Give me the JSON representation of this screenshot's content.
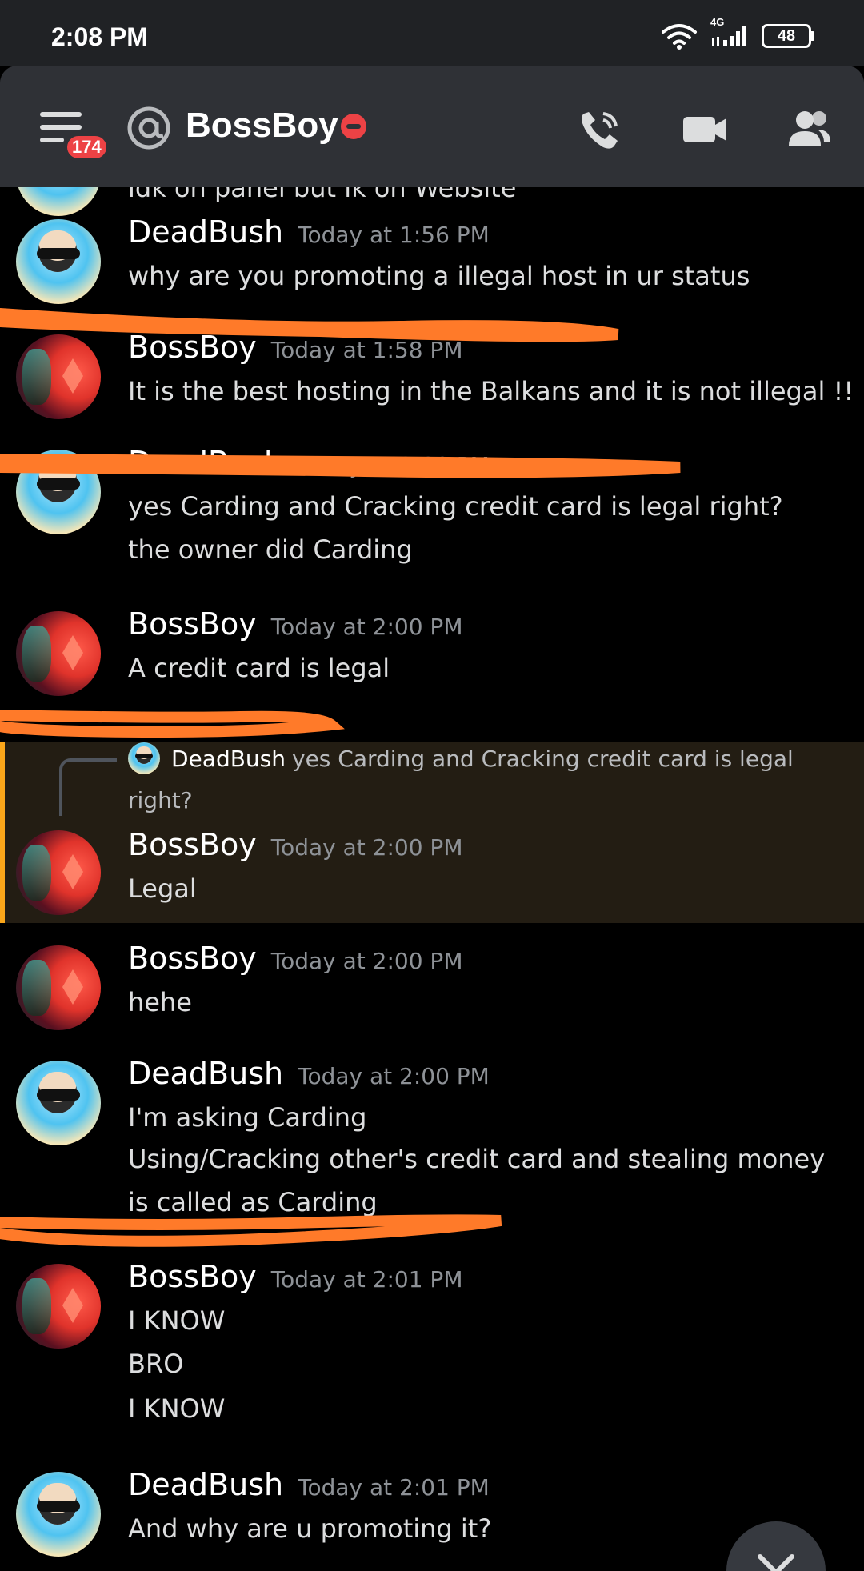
{
  "status_bar": {
    "time": "2:08 PM",
    "network": "4G",
    "battery": "48"
  },
  "header": {
    "unread_badge": "174",
    "channel_name": "BossBoy",
    "status": "do-not-disturb",
    "icons": [
      "menu-icon",
      "at-icon",
      "phone-call-icon",
      "video-call-icon",
      "members-icon"
    ]
  },
  "chat": {
    "cut_off_text": "idk on panel but ik on Website",
    "messages": [
      {
        "author": "DeadBush",
        "timestamp": "Today at 1:56 PM",
        "lines": [
          "why are you promoting a illegal host in ur status"
        ]
      },
      {
        "author": "BossBoy",
        "timestamp": "Today at 1:58 PM",
        "lines": [
          "It is the best hosting in the Balkans and it is not illegal !!"
        ]
      },
      {
        "author": "DeadBush",
        "timestamp": "Today at 2:00 PM",
        "lines": [
          "yes Carding and Cracking credit card is legal right?",
          "the owner did Carding"
        ]
      },
      {
        "author": "BossBoy",
        "timestamp": "Today at 2:00 PM",
        "lines": [
          "A credit card is legal"
        ]
      },
      {
        "author": "BossBoy",
        "timestamp": "Today at 2:00 PM",
        "lines": [
          "Legal"
        ],
        "reply_to": {
          "author": "DeadBush",
          "text_line1": "yes Carding and Cracking credit card is legal",
          "text_line2": "right?"
        }
      },
      {
        "author": "BossBoy",
        "timestamp": "Today at 2:00 PM",
        "lines": [
          "hehe"
        ]
      },
      {
        "author": "DeadBush",
        "timestamp": "Today at 2:00 PM",
        "lines": [
          "I'm asking Carding",
          "Using/Cracking other's credit card and stealing money",
          "is called as Carding"
        ]
      },
      {
        "author": "BossBoy",
        "timestamp": "Today at 2:01 PM",
        "lines": [
          "I KNOW",
          "BRO",
          "I KNOW"
        ]
      },
      {
        "author": "DeadBush",
        "timestamp": "Today at 2:01 PM",
        "lines": [
          "And why are u promoting it?"
        ]
      }
    ]
  },
  "colors": {
    "header_bg": "#2f3136",
    "chat_bg": "#000000",
    "timestamp": "#8e9297",
    "reply_highlight": "#231d13",
    "reply_bar": "#faa61a",
    "annotation_stroke": "#ff7a29",
    "dnd_red": "#ed4245"
  }
}
